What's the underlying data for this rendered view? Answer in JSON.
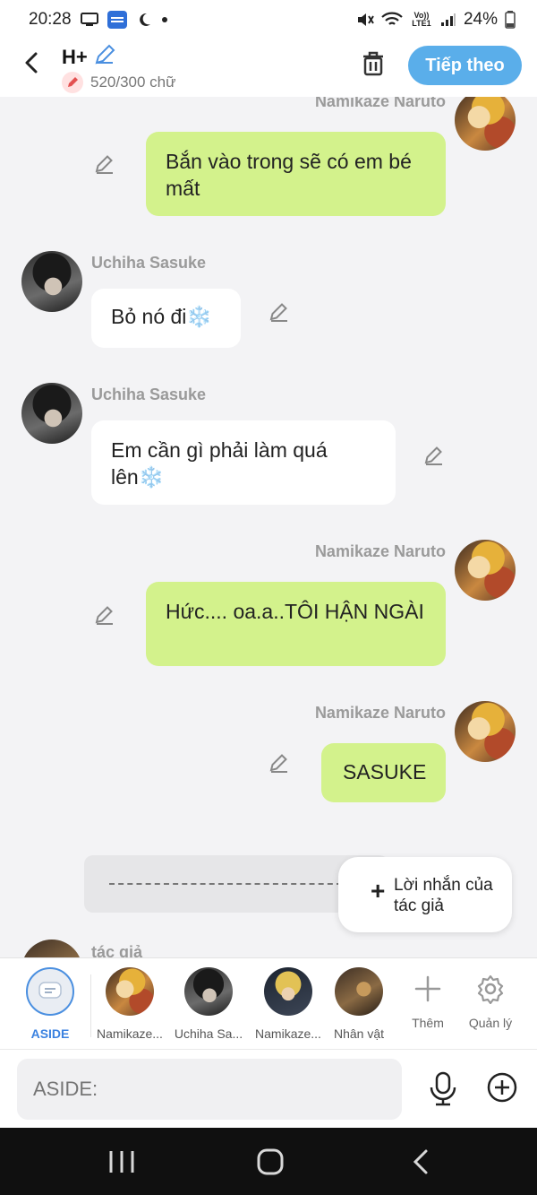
{
  "status_bar": {
    "time": "20:28",
    "battery": "24%",
    "icons": [
      "screen-cast-icon",
      "novel-toon-icon",
      "moon-icon",
      "dot-icon",
      "mute-icon",
      "wifi-icon",
      "volte-icon",
      "signal-icon",
      "battery-icon"
    ],
    "lte_label": "Vo)) LTE1"
  },
  "header": {
    "title": "H+",
    "word_count": "520/300 chữ",
    "next_label": "Tiếp theo"
  },
  "messages": [
    {
      "sender": "Namikaze Naruto",
      "side": "right",
      "text": "Bắn vào trong sẽ có em bé mất"
    },
    {
      "sender": "Uchiha Sasuke",
      "side": "left",
      "text": "Bỏ nó đi❄️"
    },
    {
      "sender": "Uchiha Sasuke",
      "side": "left",
      "text": "Em cần gì phải làm quá lên❄️"
    },
    {
      "sender": "Namikaze Naruto",
      "side": "right",
      "text": "Hức.... oa.a..TÔI HẬN NGÀI"
    },
    {
      "sender": "Namikaze Naruto",
      "side": "right",
      "text": "SASUKE"
    }
  ],
  "divider_text": "--------------------------------------------",
  "author_note_button": "Lời nhắn của tác giả",
  "partial_sender": "tác giả",
  "characters": [
    {
      "label": "ASIDE"
    },
    {
      "label": "Namikaze..."
    },
    {
      "label": "Uchiha Sa..."
    },
    {
      "label": "Namikaze..."
    },
    {
      "label": "Nhân vật"
    }
  ],
  "tools": [
    {
      "label": "Thêm",
      "icon": "plus-icon"
    },
    {
      "label": "Quản lý",
      "icon": "gear-icon"
    }
  ],
  "input": {
    "placeholder": "ASIDE:"
  },
  "colors": {
    "accent": "#5aaeea",
    "green_bubble": "#d3f28c",
    "aside_blue": "#3b82e0"
  }
}
